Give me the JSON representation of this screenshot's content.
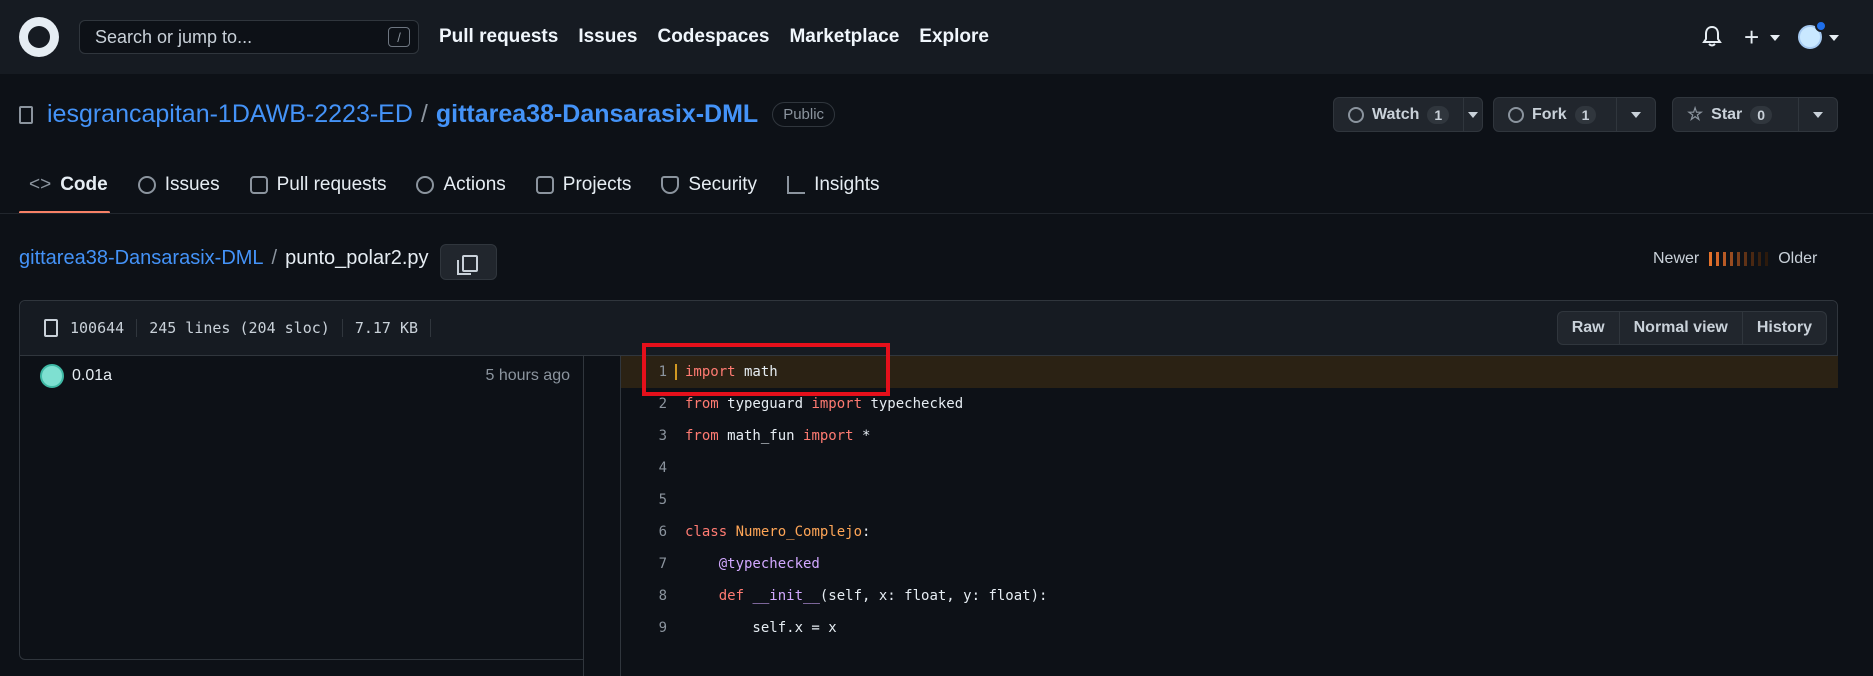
{
  "header": {
    "search_placeholder": "Search or jump to...",
    "search_shortcut": "/",
    "nav": [
      "Pull requests",
      "Issues",
      "Codespaces",
      "Marketplace",
      "Explore"
    ]
  },
  "repo": {
    "owner": "iesgrancapitan-1DAWB-2223-ED",
    "separator": "/",
    "name": "gittarea38-Dansarasix-DML",
    "visibility": "Public",
    "watch": {
      "label": "Watch",
      "count": "1"
    },
    "fork": {
      "label": "Fork",
      "count": "1"
    },
    "star": {
      "label": "Star",
      "count": "0"
    }
  },
  "tabs": [
    {
      "label": "Code",
      "icon": "code-icon",
      "active": true
    },
    {
      "label": "Issues",
      "icon": "issue-icon"
    },
    {
      "label": "Pull requests",
      "icon": "pull-request-icon"
    },
    {
      "label": "Actions",
      "icon": "play-icon"
    },
    {
      "label": "Projects",
      "icon": "table-icon"
    },
    {
      "label": "Security",
      "icon": "shield-icon"
    },
    {
      "label": "Insights",
      "icon": "graph-icon"
    }
  ],
  "breadcrumb": {
    "repo": "gittarea38-Dansarasix-DML",
    "separator": "/",
    "file": "punto_polar2.py"
  },
  "blame_scale": {
    "newer": "Newer",
    "older": "Older",
    "colors": [
      "#e3712a",
      "#d4672a",
      "#b85a25",
      "#9a4c20",
      "#7d3f1b",
      "#603216",
      "#4a2812",
      "#3a210f",
      "#2c1a0c"
    ]
  },
  "file_info": {
    "mode": "100644",
    "lines": "245 lines (204 sloc)",
    "size": "7.17 KB"
  },
  "view_buttons": {
    "raw": "Raw",
    "normal": "Normal view",
    "history": "History"
  },
  "commit": {
    "message": "0.01a",
    "time": "5 hours ago"
  },
  "code_lines": [
    {
      "n": "1",
      "highlight": true
    },
    {
      "n": "2"
    },
    {
      "n": "3"
    },
    {
      "n": "4"
    },
    {
      "n": "5"
    },
    {
      "n": "6"
    },
    {
      "n": "7"
    },
    {
      "n": "8"
    },
    {
      "n": "9"
    }
  ],
  "code_text": {
    "l1_kw": "import",
    "l1_rest": " math",
    "l2_kw1": "from",
    "l2_mod": " typeguard ",
    "l2_kw2": "import",
    "l2_rest": " typechecked",
    "l3_kw1": "from",
    "l3_mod": " math_fun ",
    "l3_kw2": "import",
    "l3_rest": " *",
    "l6_kw": "class",
    "l6_name": " Numero_Complejo",
    "l6_rest": ":",
    "l7_dec": "    @typechecked",
    "l8_indent": "    ",
    "l8_kw": "def",
    "l8_fn": " __init__",
    "l8_rest": "(self, x: float, y: float):",
    "l9": "        self.x = x"
  },
  "colors": {
    "accent_tab": "#f78166",
    "link": "#4493f8",
    "highlight_box": "#e5101b"
  }
}
